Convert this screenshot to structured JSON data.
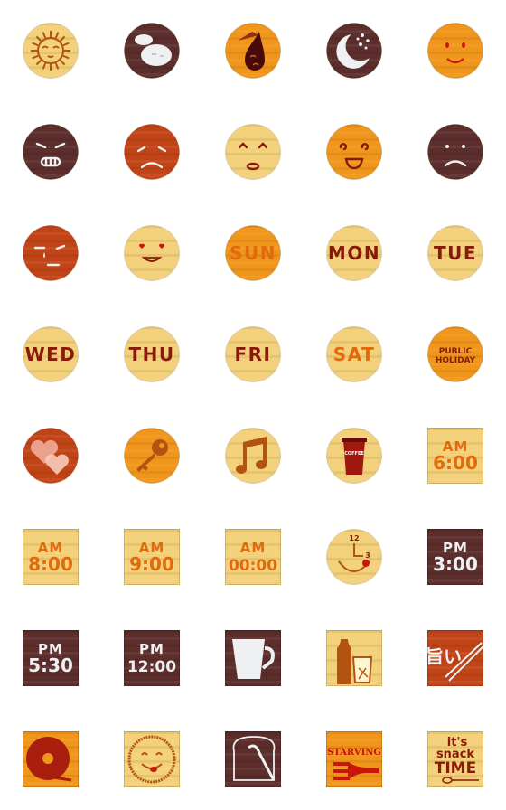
{
  "colors": {
    "light_wood": "#f3d07a",
    "orange_wood": "#f0961c",
    "dark_wood": "#5b2d2b",
    "rust_wood": "#c04417",
    "label_dark_red": "#8a1a08",
    "label_orange": "#e06a0c",
    "white": "#eef0f2"
  },
  "stickers": [
    {
      "icon": "sun-face-icon",
      "shape": "circle",
      "bg": "light_wood"
    },
    {
      "icon": "cloud-face-icon",
      "shape": "circle",
      "bg": "dark_wood"
    },
    {
      "icon": "umbrella-drop-icon",
      "shape": "circle",
      "bg": "orange_wood"
    },
    {
      "icon": "moon-hearts-icon",
      "shape": "circle",
      "bg": "dark_wood"
    },
    {
      "icon": "smile-face-icon",
      "shape": "circle",
      "bg": "orange_wood"
    },
    {
      "icon": "angry-face-icon",
      "shape": "circle",
      "bg": "dark_wood"
    },
    {
      "icon": "worried-face-icon",
      "shape": "circle",
      "bg": "rust_wood"
    },
    {
      "icon": "surprised-face-icon",
      "shape": "circle",
      "bg": "light_wood"
    },
    {
      "icon": "grin-face-icon",
      "shape": "circle",
      "bg": "orange_wood"
    },
    {
      "icon": "sad-face-icon",
      "shape": "circle",
      "bg": "dark_wood"
    },
    {
      "icon": "crying-face-icon",
      "shape": "circle",
      "bg": "rust_wood"
    },
    {
      "icon": "love-face-icon",
      "shape": "circle",
      "bg": "light_wood"
    },
    {
      "label": [
        "SUN"
      ],
      "shape": "circle",
      "bg": "orange_wood",
      "fg": "label_orange",
      "inner": "light_wood"
    },
    {
      "label": [
        "MON"
      ],
      "shape": "circle",
      "bg": "light_wood",
      "fg": "label_dark_red"
    },
    {
      "label": [
        "TUE"
      ],
      "shape": "circle",
      "bg": "light_wood",
      "fg": "label_dark_red"
    },
    {
      "label": [
        "WED"
      ],
      "shape": "circle",
      "bg": "light_wood",
      "fg": "label_dark_red"
    },
    {
      "label": [
        "THU"
      ],
      "shape": "circle",
      "bg": "light_wood",
      "fg": "label_dark_red"
    },
    {
      "label": [
        "FRI"
      ],
      "shape": "circle",
      "bg": "light_wood",
      "fg": "label_dark_red"
    },
    {
      "label": [
        "SAT"
      ],
      "shape": "circle",
      "bg": "light_wood",
      "fg": "label_orange"
    },
    {
      "label": [
        "PUBLIC",
        "HOLIDAY"
      ],
      "shape": "circle",
      "bg": "orange_wood",
      "fg": "label_dark_red"
    },
    {
      "icon": "hearts-icon",
      "shape": "circle",
      "bg": "rust_wood"
    },
    {
      "icon": "key-icon",
      "shape": "circle",
      "bg": "orange_wood"
    },
    {
      "icon": "music-note-icon",
      "shape": "circle",
      "bg": "light_wood"
    },
    {
      "icon": "coffee-cup-icon",
      "shape": "circle",
      "bg": "light_wood",
      "label": [
        "COFFEE"
      ]
    },
    {
      "label": [
        "AM",
        "6:00"
      ],
      "shape": "square",
      "bg": "light_wood",
      "fg": "label_orange"
    },
    {
      "label": [
        "AM",
        "8:00"
      ],
      "shape": "square",
      "bg": "light_wood",
      "fg": "label_orange"
    },
    {
      "label": [
        "AM",
        "9:00"
      ],
      "shape": "square",
      "bg": "light_wood",
      "fg": "label_orange"
    },
    {
      "label": [
        "AM",
        "00:00"
      ],
      "shape": "square",
      "bg": "light_wood",
      "fg": "label_orange"
    },
    {
      "icon": "clock-face-icon",
      "shape": "circle",
      "bg": "light_wood",
      "label": [
        "12",
        "3"
      ]
    },
    {
      "label": [
        "PM",
        "3:00"
      ],
      "shape": "square",
      "bg": "dark_wood",
      "fg": "white"
    },
    {
      "label": [
        "PM",
        "5:30"
      ],
      "shape": "square",
      "bg": "dark_wood",
      "fg": "white"
    },
    {
      "label": [
        "PM",
        "12:00"
      ],
      "shape": "square",
      "bg": "dark_wood",
      "fg": "white"
    },
    {
      "icon": "mug-icon",
      "shape": "square",
      "bg": "dark_wood"
    },
    {
      "icon": "bottle-glass-icon",
      "shape": "square",
      "bg": "light_wood"
    },
    {
      "icon": "chopsticks-icon",
      "shape": "square",
      "bg": "rust_wood",
      "label": [
        "旨い"
      ]
    },
    {
      "icon": "donut-icon",
      "shape": "square",
      "bg": "orange_wood"
    },
    {
      "icon": "tongue-smile-icon",
      "shape": "square",
      "bg": "light_wood"
    },
    {
      "icon": "toast-icon",
      "shape": "square",
      "bg": "dark_wood"
    },
    {
      "icon": "fork-icon",
      "shape": "square",
      "bg": "orange_wood",
      "label": [
        "STARVING"
      ]
    },
    {
      "icon": "spoon-icon",
      "shape": "square",
      "bg": "light_wood",
      "label": [
        "it's",
        "snack",
        "TIME"
      ]
    }
  ]
}
